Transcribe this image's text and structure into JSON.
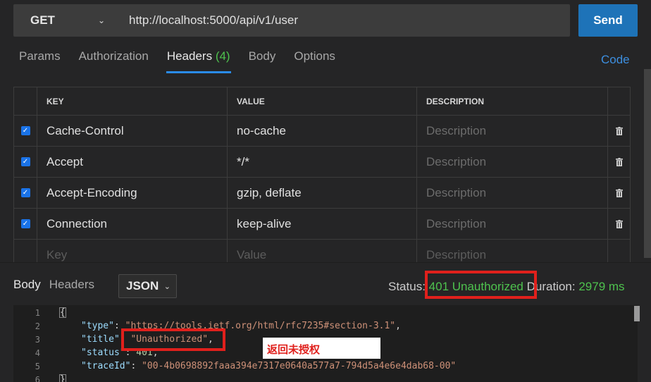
{
  "request": {
    "method": "GET",
    "url": "http://localhost:5000/api/v1/user",
    "send_label": "Send"
  },
  "tabs": [
    {
      "label": "Params"
    },
    {
      "label": "Authorization"
    },
    {
      "label": "Headers",
      "count": "(4)"
    },
    {
      "label": "Body"
    },
    {
      "label": "Options"
    }
  ],
  "code_link": "Code",
  "headers_table": {
    "columns": {
      "key": "KEY",
      "value": "VALUE",
      "description": "DESCRIPTION"
    },
    "rows": [
      {
        "checked": true,
        "key": "Cache-Control",
        "value": "no-cache",
        "description": "Description"
      },
      {
        "checked": true,
        "key": "Accept",
        "value": "*/*",
        "description": "Description"
      },
      {
        "checked": true,
        "key": "Accept-Encoding",
        "value": "gzip, deflate",
        "description": "Description"
      },
      {
        "checked": true,
        "key": "Connection",
        "value": "keep-alive",
        "description": "Description"
      }
    ],
    "placeholder": {
      "key": "Key",
      "value": "Value",
      "description": "Description"
    }
  },
  "response": {
    "tabs": [
      {
        "label": "Body"
      },
      {
        "label": "Headers"
      }
    ],
    "format": "JSON",
    "status_label": "Status:",
    "status_value": "401 Unauthorized",
    "duration_label": "Duration:",
    "duration_value": "2979 ms",
    "body_lines": [
      {
        "n": "1",
        "text": "{"
      },
      {
        "n": "2",
        "key": "\"type\"",
        "value": "\"https://tools.ietf.org/html/rfc7235#section-3.1\"",
        "tail": ","
      },
      {
        "n": "3",
        "key": "\"title\"",
        "value": "\"Unauthorized\"",
        "tail": ","
      },
      {
        "n": "4",
        "key": "\"status\"",
        "value": "401",
        "tail": ","
      },
      {
        "n": "5",
        "key": "\"traceId\"",
        "value": "\"00-4b0698892faaa394e7317e0640a577a7-794d5a4e6e4dab68-00\"",
        "tail": ""
      },
      {
        "n": "6",
        "text": "}"
      }
    ]
  },
  "annotation": "返回未授权",
  "colors": {
    "accent": "#1e73b8",
    "highlight": "#e0201c",
    "status_ok": "#4ec24e"
  }
}
